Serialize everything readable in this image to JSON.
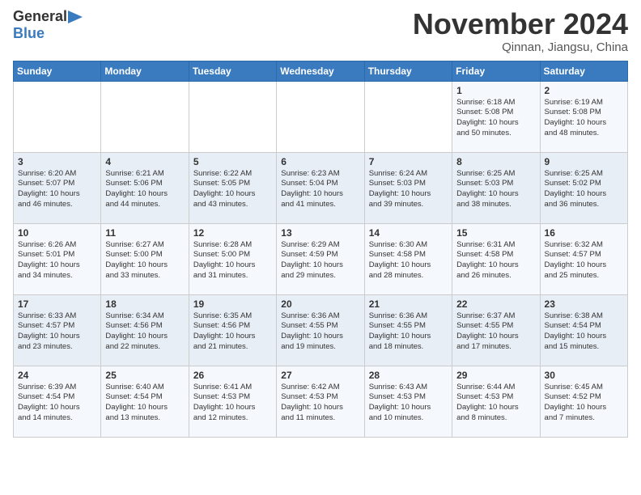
{
  "header": {
    "logo_general": "General",
    "logo_blue": "Blue",
    "month_title": "November 2024",
    "subtitle": "Qinnan, Jiangsu, China"
  },
  "weekdays": [
    "Sunday",
    "Monday",
    "Tuesday",
    "Wednesday",
    "Thursday",
    "Friday",
    "Saturday"
  ],
  "weeks": [
    [
      {
        "day": "",
        "info": ""
      },
      {
        "day": "",
        "info": ""
      },
      {
        "day": "",
        "info": ""
      },
      {
        "day": "",
        "info": ""
      },
      {
        "day": "",
        "info": ""
      },
      {
        "day": "1",
        "info": "Sunrise: 6:18 AM\nSunset: 5:08 PM\nDaylight: 10 hours\nand 50 minutes."
      },
      {
        "day": "2",
        "info": "Sunrise: 6:19 AM\nSunset: 5:08 PM\nDaylight: 10 hours\nand 48 minutes."
      }
    ],
    [
      {
        "day": "3",
        "info": "Sunrise: 6:20 AM\nSunset: 5:07 PM\nDaylight: 10 hours\nand 46 minutes."
      },
      {
        "day": "4",
        "info": "Sunrise: 6:21 AM\nSunset: 5:06 PM\nDaylight: 10 hours\nand 44 minutes."
      },
      {
        "day": "5",
        "info": "Sunrise: 6:22 AM\nSunset: 5:05 PM\nDaylight: 10 hours\nand 43 minutes."
      },
      {
        "day": "6",
        "info": "Sunrise: 6:23 AM\nSunset: 5:04 PM\nDaylight: 10 hours\nand 41 minutes."
      },
      {
        "day": "7",
        "info": "Sunrise: 6:24 AM\nSunset: 5:03 PM\nDaylight: 10 hours\nand 39 minutes."
      },
      {
        "day": "8",
        "info": "Sunrise: 6:25 AM\nSunset: 5:03 PM\nDaylight: 10 hours\nand 38 minutes."
      },
      {
        "day": "9",
        "info": "Sunrise: 6:25 AM\nSunset: 5:02 PM\nDaylight: 10 hours\nand 36 minutes."
      }
    ],
    [
      {
        "day": "10",
        "info": "Sunrise: 6:26 AM\nSunset: 5:01 PM\nDaylight: 10 hours\nand 34 minutes."
      },
      {
        "day": "11",
        "info": "Sunrise: 6:27 AM\nSunset: 5:00 PM\nDaylight: 10 hours\nand 33 minutes."
      },
      {
        "day": "12",
        "info": "Sunrise: 6:28 AM\nSunset: 5:00 PM\nDaylight: 10 hours\nand 31 minutes."
      },
      {
        "day": "13",
        "info": "Sunrise: 6:29 AM\nSunset: 4:59 PM\nDaylight: 10 hours\nand 29 minutes."
      },
      {
        "day": "14",
        "info": "Sunrise: 6:30 AM\nSunset: 4:58 PM\nDaylight: 10 hours\nand 28 minutes."
      },
      {
        "day": "15",
        "info": "Sunrise: 6:31 AM\nSunset: 4:58 PM\nDaylight: 10 hours\nand 26 minutes."
      },
      {
        "day": "16",
        "info": "Sunrise: 6:32 AM\nSunset: 4:57 PM\nDaylight: 10 hours\nand 25 minutes."
      }
    ],
    [
      {
        "day": "17",
        "info": "Sunrise: 6:33 AM\nSunset: 4:57 PM\nDaylight: 10 hours\nand 23 minutes."
      },
      {
        "day": "18",
        "info": "Sunrise: 6:34 AM\nSunset: 4:56 PM\nDaylight: 10 hours\nand 22 minutes."
      },
      {
        "day": "19",
        "info": "Sunrise: 6:35 AM\nSunset: 4:56 PM\nDaylight: 10 hours\nand 21 minutes."
      },
      {
        "day": "20",
        "info": "Sunrise: 6:36 AM\nSunset: 4:55 PM\nDaylight: 10 hours\nand 19 minutes."
      },
      {
        "day": "21",
        "info": "Sunrise: 6:36 AM\nSunset: 4:55 PM\nDaylight: 10 hours\nand 18 minutes."
      },
      {
        "day": "22",
        "info": "Sunrise: 6:37 AM\nSunset: 4:55 PM\nDaylight: 10 hours\nand 17 minutes."
      },
      {
        "day": "23",
        "info": "Sunrise: 6:38 AM\nSunset: 4:54 PM\nDaylight: 10 hours\nand 15 minutes."
      }
    ],
    [
      {
        "day": "24",
        "info": "Sunrise: 6:39 AM\nSunset: 4:54 PM\nDaylight: 10 hours\nand 14 minutes."
      },
      {
        "day": "25",
        "info": "Sunrise: 6:40 AM\nSunset: 4:54 PM\nDaylight: 10 hours\nand 13 minutes."
      },
      {
        "day": "26",
        "info": "Sunrise: 6:41 AM\nSunset: 4:53 PM\nDaylight: 10 hours\nand 12 minutes."
      },
      {
        "day": "27",
        "info": "Sunrise: 6:42 AM\nSunset: 4:53 PM\nDaylight: 10 hours\nand 11 minutes."
      },
      {
        "day": "28",
        "info": "Sunrise: 6:43 AM\nSunset: 4:53 PM\nDaylight: 10 hours\nand 10 minutes."
      },
      {
        "day": "29",
        "info": "Sunrise: 6:44 AM\nSunset: 4:53 PM\nDaylight: 10 hours\nand 8 minutes."
      },
      {
        "day": "30",
        "info": "Sunrise: 6:45 AM\nSunset: 4:52 PM\nDaylight: 10 hours\nand 7 minutes."
      }
    ]
  ]
}
